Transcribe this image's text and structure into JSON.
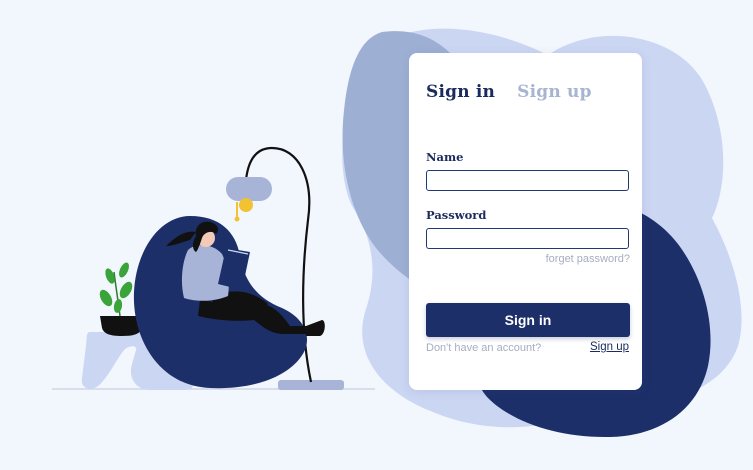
{
  "colors": {
    "page_background": "#f2f6fd",
    "navy": "#1d2f69",
    "blob_light": "#cbd6f3",
    "blob_medium": "#9eafd4",
    "tab_inactive": "#a7b4d2",
    "muted_text": "#a5aec0",
    "lamp_bulb": "#f1c232",
    "plant_green": "#3aa33a"
  },
  "illustration": {
    "subject": "woman reading a book in a bean-bag chair beside a floor lamp, a potted plant and a mug on a side table"
  },
  "auth_card": {
    "tabs": [
      {
        "label": "Sign in",
        "active": true
      },
      {
        "label": "Sign up",
        "active": false
      }
    ],
    "name_field": {
      "label": "Name",
      "value": "",
      "placeholder": ""
    },
    "password_field": {
      "label": "Password",
      "value": "",
      "placeholder": ""
    },
    "forgot_password_link": "forget password?",
    "submit_button": "Sign in",
    "no_account_text": "Don't have an account?",
    "signup_link": "Sign up"
  }
}
